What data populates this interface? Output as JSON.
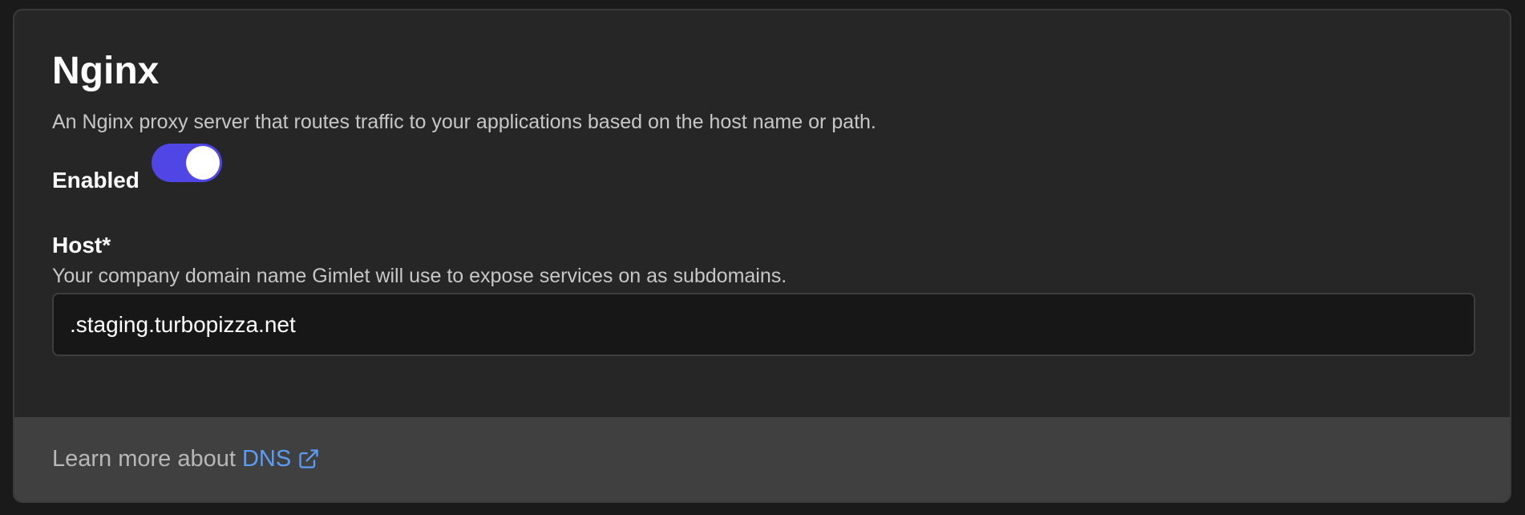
{
  "section": {
    "title": "Nginx",
    "description": "An Nginx proxy server that routes traffic to your applications based on the host name or path."
  },
  "enabled": {
    "label": "Enabled",
    "value": true
  },
  "host": {
    "label": "Host*",
    "help": "Your company domain name Gimlet will use to expose services on as subdomains.",
    "value": ".staging.turbopizza.net"
  },
  "footer": {
    "prefix": "Learn more about",
    "link_text": "DNS",
    "link_icon": "external-link-icon"
  },
  "colors": {
    "accent": "#4f46e5",
    "link": "#5b9cf5",
    "panel": "#262626",
    "footer": "#404040"
  }
}
